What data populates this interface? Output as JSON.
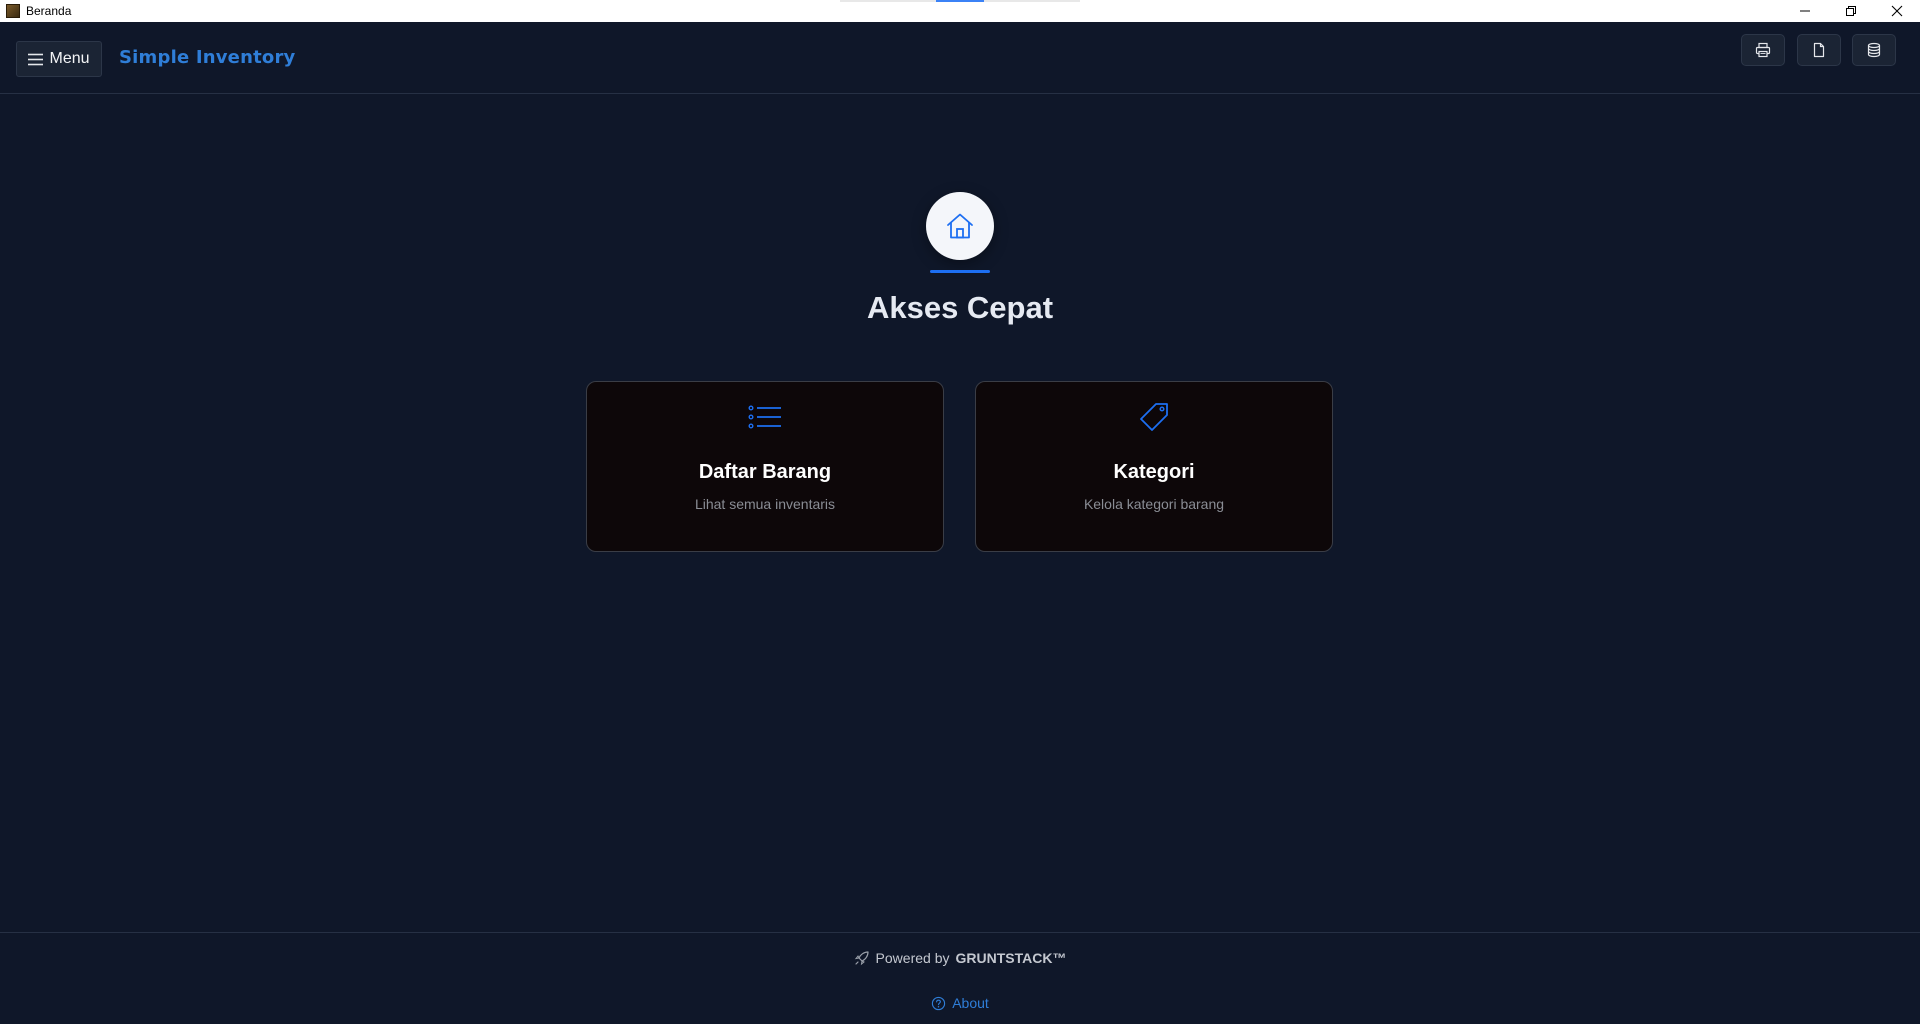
{
  "window": {
    "title": "Beranda"
  },
  "header": {
    "menu_label": "Menu",
    "brand": "Simple Inventory",
    "actions": [
      "printer-icon",
      "file-icon",
      "database-icon"
    ]
  },
  "hero": {
    "icon": "home-icon",
    "title": "Akses Cepat"
  },
  "cards": [
    {
      "icon": "list-icon",
      "title": "Daftar Barang",
      "description": "Lihat semua inventaris"
    },
    {
      "icon": "tag-icon",
      "title": "Kategori",
      "description": "Kelola kategori barang"
    }
  ],
  "footer": {
    "powered_prefix": "Powered by",
    "powered_brand": "GRUNTSTACK™",
    "about_label": "About"
  },
  "colors": {
    "background": "#0f1729",
    "accent": "#2f7ed8",
    "card_bg": "#0d0709"
  }
}
